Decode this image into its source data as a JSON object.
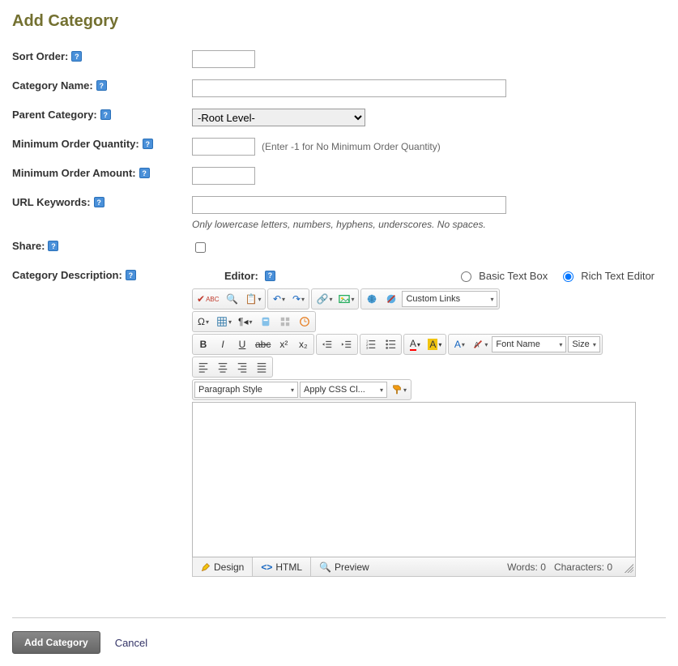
{
  "title": "Add Category",
  "labels": {
    "sort_order": "Sort Order:",
    "category_name": "Category Name:",
    "parent_category": "Parent Category:",
    "min_qty": "Minimum Order Quantity:",
    "min_amount": "Minimum Order Amount:",
    "url_keywords": "URL Keywords:",
    "share": "Share:",
    "category_desc": "Category Description:",
    "editor": "Editor:"
  },
  "values": {
    "sort_order": "",
    "category_name": "",
    "parent_category_selected": "-Root Level-",
    "min_qty": "",
    "min_amount": "",
    "url_keywords": "",
    "share_checked": false
  },
  "hints": {
    "min_qty": "(Enter -1 for No Minimum Order Quantity)",
    "url_keywords": "Only lowercase letters, numbers, hyphens, underscores. No spaces."
  },
  "editor_modes": {
    "basic": "Basic Text Box",
    "rich": "Rich Text Editor",
    "selected": "rich"
  },
  "rte": {
    "custom_links": "Custom Links",
    "paragraph_style": "Paragraph Style",
    "apply_css": "Apply CSS Cl...",
    "font_name": "Font Name",
    "size": "Size",
    "tabs": {
      "design": "Design",
      "html": "HTML",
      "preview": "Preview"
    },
    "stats": {
      "words_label": "Words:",
      "words": 0,
      "chars_label": "Characters:",
      "chars": 0
    }
  },
  "footer": {
    "submit": "Add Category",
    "cancel": "Cancel"
  }
}
